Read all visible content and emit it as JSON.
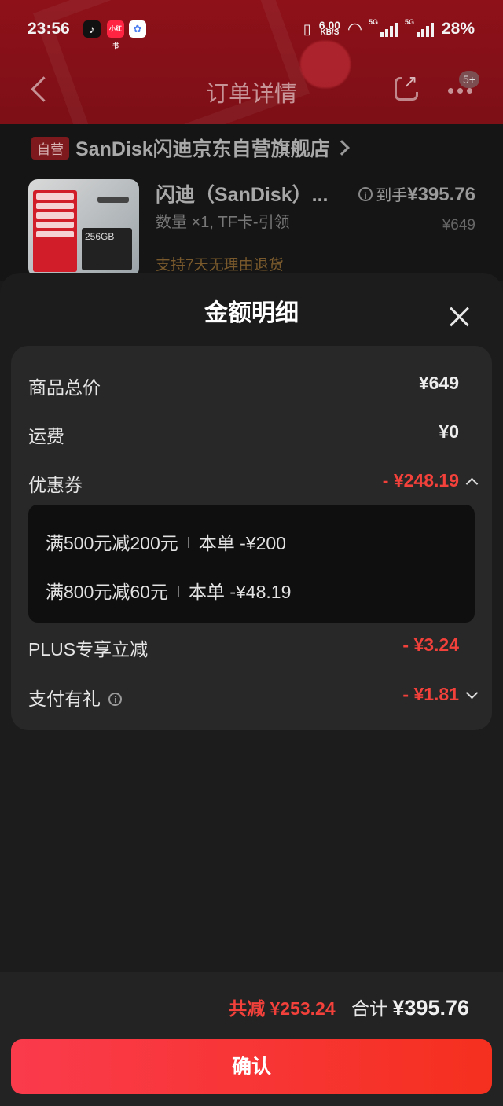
{
  "status_bar": {
    "time": "23:56",
    "app_icons": [
      "tiktok-icon",
      "xiaohongshu-icon",
      "multi-app-icon"
    ],
    "xhs_text": "小红书",
    "net_speed": "6.00",
    "net_unit": "KB/S",
    "signal1": "5G",
    "signal2": "5G",
    "battery": "28%"
  },
  "navbar": {
    "title": "订单详情",
    "badge": "5+"
  },
  "order": {
    "self_tag": "自营",
    "shop_name": "SanDisk闪迪京东自营旗舰店",
    "product_name": "闪迪（SanDisk）...",
    "spec": "数量 ×1, TF卡-引领",
    "service": "支持7天无理由退货",
    "price_prefix": "到手",
    "price": "¥395.76",
    "original_price": "¥649",
    "thumb_text": "256GB"
  },
  "sheet": {
    "title": "金额明细",
    "rows": {
      "goods_total": {
        "label": "商品总价",
        "value": "¥649"
      },
      "shipping": {
        "label": "运费",
        "value": "¥0"
      },
      "coupon": {
        "label": "优惠券",
        "value": "- ¥248.19"
      },
      "plus": {
        "label": "PLUS专享立减",
        "value": "- ¥3.24"
      },
      "pay_gift": {
        "label": "支付有礼",
        "value": "- ¥1.81"
      }
    },
    "coupons": [
      {
        "rule": "满500元减200元",
        "detail": "本单 -¥200"
      },
      {
        "rule": "满800元减60元",
        "detail": "本单 -¥48.19"
      }
    ]
  },
  "footer": {
    "saved": "共减 ¥253.24",
    "total_label": "合计",
    "total_value": "¥395.76",
    "confirm": "确认"
  },
  "colors": {
    "header_red": "#8e1119",
    "accent_red": "#f2403a",
    "button_gradient_start": "#fa3b4c",
    "button_gradient_end": "#f5301f"
  }
}
